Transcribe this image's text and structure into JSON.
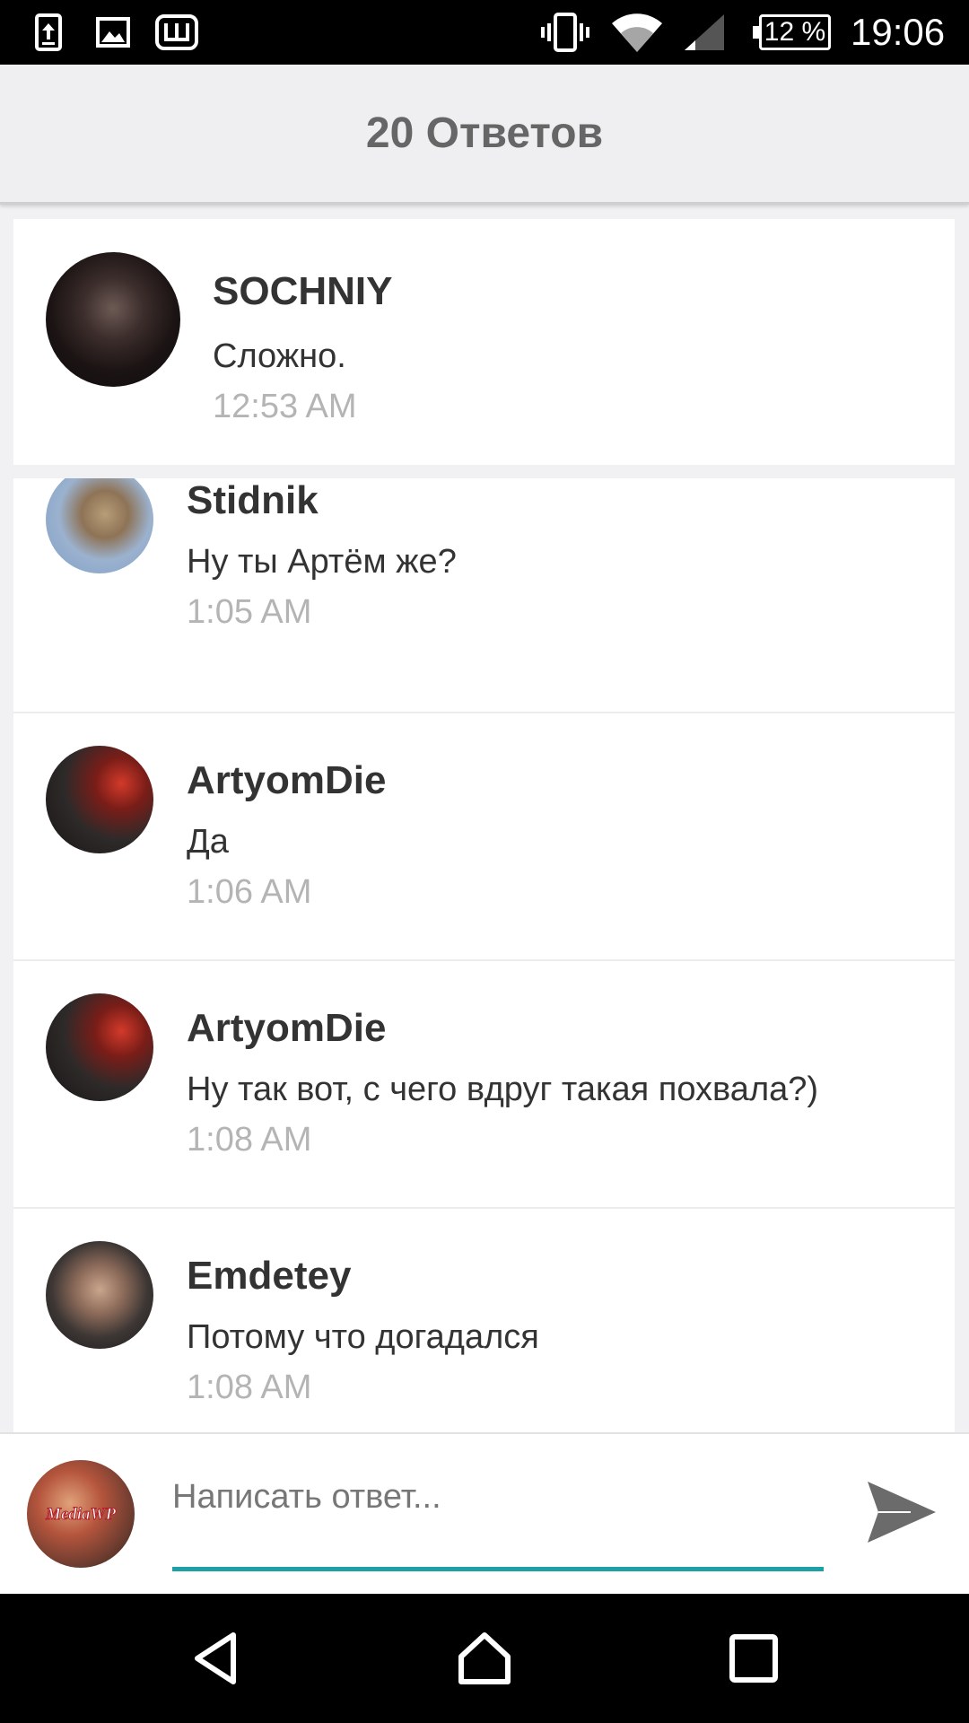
{
  "status_bar": {
    "icons": [
      "upload-icon",
      "image-icon",
      "app-sh-icon",
      "vibrate-icon",
      "wifi-icon",
      "signal-icon"
    ],
    "battery": "12 %",
    "time": "19:06"
  },
  "header": {
    "title": "20 Ответов"
  },
  "parent_comment": {
    "author": "SOCHNIY",
    "text": "Сложно.",
    "time": "12:53 AM"
  },
  "replies": [
    {
      "author": "Stidnik",
      "text": "Ну ты Артём же?",
      "time": "1:05 AM"
    },
    {
      "author": "ArtyomDie",
      "text": "Да",
      "time": "1:06 AM"
    },
    {
      "author": "ArtyomDie",
      "text": "Ну так вот, с чего вдруг такая похвала?)",
      "time": "1:08 AM"
    },
    {
      "author": "Emdetey",
      "text": "Потому что догадался",
      "time": "1:08 AM"
    }
  ],
  "composer": {
    "placeholder": "Написать ответ...",
    "avatar_label": "MediaWP",
    "accent_color": "#1ea1a5"
  },
  "nav_bar": {
    "icons": [
      "back-icon",
      "home-icon",
      "recents-icon"
    ]
  }
}
